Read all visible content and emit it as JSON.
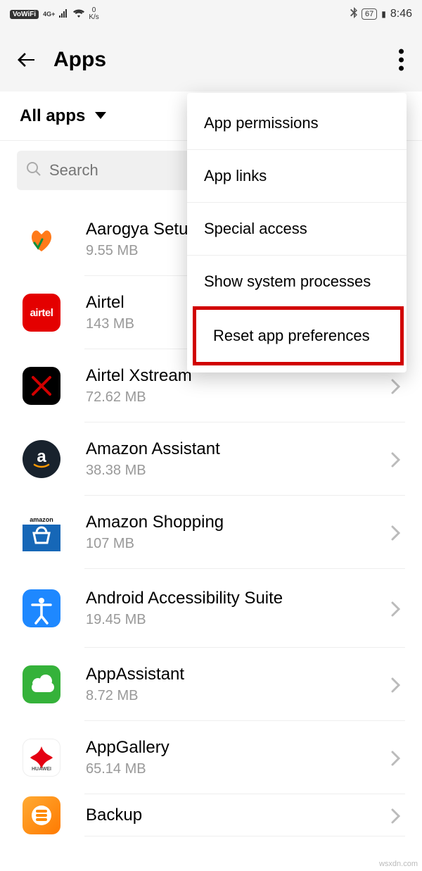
{
  "status": {
    "vowifi": "VoWiFi",
    "speed_value": "0",
    "speed_unit": "K/s",
    "net": "4G+",
    "battery": "67",
    "time": "8:46"
  },
  "header": {
    "title": "Apps"
  },
  "filter": {
    "label": "All apps"
  },
  "search": {
    "placeholder": "Search"
  },
  "menu": {
    "items": [
      "App permissions",
      "App links",
      "Special access",
      "Show system processes",
      "Reset app preferences"
    ]
  },
  "apps": [
    {
      "name": "Aarogya Setu",
      "size": "9.55 MB",
      "icon": "aarogya"
    },
    {
      "name": "Airtel",
      "size": "143 MB",
      "icon": "airtel"
    },
    {
      "name": "Airtel Xstream",
      "size": "72.62 MB",
      "icon": "xstream"
    },
    {
      "name": "Amazon Assistant",
      "size": "38.38 MB",
      "icon": "amazon"
    },
    {
      "name": "Amazon Shopping",
      "size": "107 MB",
      "icon": "amazon-shop"
    },
    {
      "name": "Android Accessibility Suite",
      "size": "19.45 MB",
      "icon": "accessibility"
    },
    {
      "name": "AppAssistant",
      "size": "8.72 MB",
      "icon": "appassist"
    },
    {
      "name": "AppGallery",
      "size": "65.14 MB",
      "icon": "appgallery"
    },
    {
      "name": "Backup",
      "size": "",
      "icon": "backup"
    }
  ],
  "watermark": "wsxdn.com"
}
